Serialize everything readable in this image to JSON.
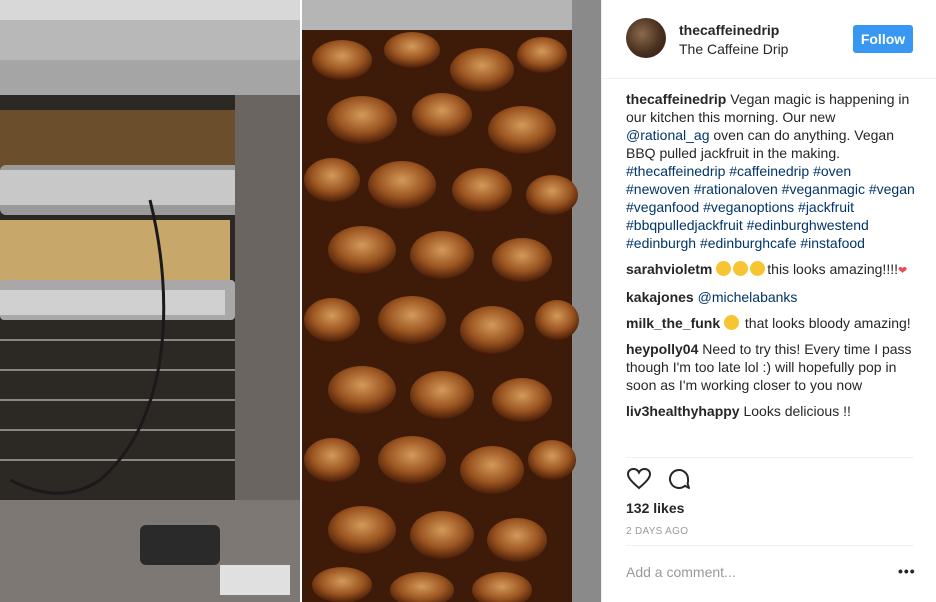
{
  "post": {
    "username": "thecaffeinedrip",
    "full_name": "The Caffeine Drip",
    "follow_label": "Follow",
    "likes": "132 likes",
    "time_ago": "2 DAYS AGO",
    "add_comment_placeholder": "Add a comment...",
    "more_label": "•••"
  },
  "caption": {
    "user": "thecaffeinedrip",
    "text_1": " Vegan magic is happening in our kitchen this morning. Our new ",
    "mention": "@rational_ag",
    "text_2": " oven can do anything. Vegan BBQ pulled jackfruit in the making. ",
    "hashtags": "#thecaffeinedrip #caffeinedrip #oven #newoven #rationaloven #veganmagic #vegan #veganfood #veganoptions #jackfruit #bbqpulledjackfruit #edinburghwestend #edinburgh #edinburghcafe #instafood"
  },
  "comments": [
    {
      "user": "sarahvioletm",
      "text": "this looks amazing!!!!",
      "emojis": 3,
      "heart": "❤"
    },
    {
      "user": "kakajones",
      "mention": "@michelabanks"
    },
    {
      "user": "milk_the_funk",
      "text": " that looks bloody amazing!",
      "emojis": 1
    },
    {
      "user": "heypolly04",
      "text": "Need to try this! Every time I pass though I'm too late lol :) will hopefully pop in soon as I'm working closer to you now"
    },
    {
      "user": "liv3healthyhappy",
      "text": "Looks delicious !!"
    }
  ],
  "icons": {
    "heart": "heart-icon",
    "comment": "comment-bubble-icon"
  },
  "colors": {
    "follow_bg": "#3897f0",
    "link": "#003569",
    "muted": "#999999"
  }
}
